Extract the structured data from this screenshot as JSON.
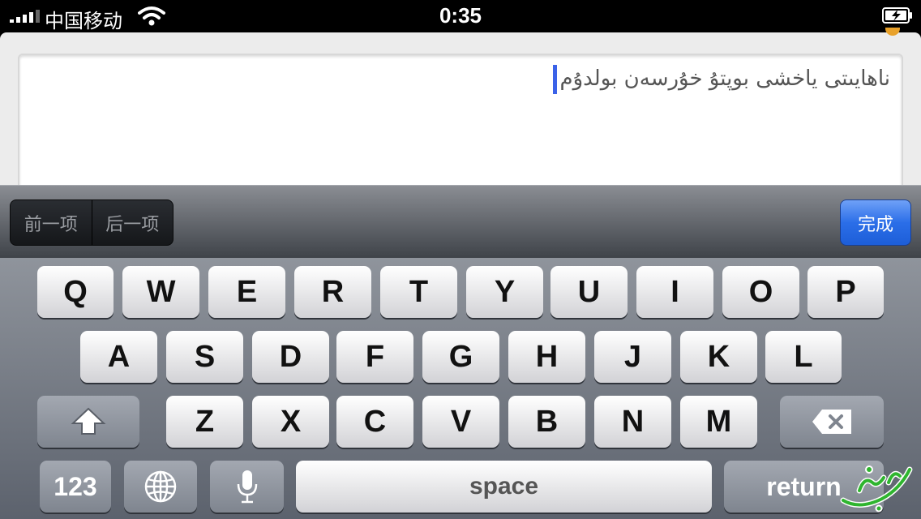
{
  "status_bar": {
    "carrier": "中国移动",
    "time": "0:35"
  },
  "text_field": {
    "value": "ناھايىتى ياخشى بوپتۇ  خۇرسەن بولدۇم"
  },
  "toolbar": {
    "prev_label": "前一项",
    "next_label": "后一项",
    "done_label": "完成"
  },
  "keyboard": {
    "row1": [
      "Q",
      "W",
      "E",
      "R",
      "T",
      "Y",
      "U",
      "I",
      "O",
      "P"
    ],
    "row2": [
      "A",
      "S",
      "D",
      "F",
      "G",
      "H",
      "J",
      "K",
      "L"
    ],
    "row3": [
      "Z",
      "X",
      "C",
      "V",
      "B",
      "N",
      "M"
    ],
    "numbers_label": "123",
    "space_label": "space",
    "return_label": "return"
  },
  "watermark": {
    "text": "ئالتۇنى"
  },
  "colors": {
    "accent": "#2b6ee8",
    "cursor": "#3b62e8",
    "keyboard_bg": "#6f747d"
  }
}
